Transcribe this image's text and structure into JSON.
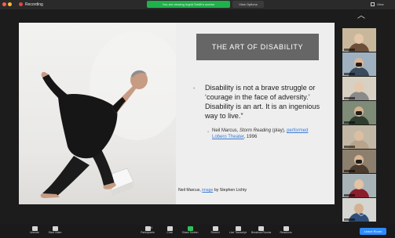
{
  "topbar": {
    "recording_label": "Recording",
    "banner_text": "You are viewing Ingrid Smith's screen",
    "view_options_label": "View Options",
    "view_label": "View",
    "window_dots": [
      "#ff5f57",
      "#febc2e",
      "#28c840"
    ],
    "rec_color": "#e8453c"
  },
  "slide": {
    "title": "THE ART OF DISABILITY",
    "quote": "Disability is not a brave struggle or ‘courage in the face of adversity.’ Disability is an art. It is an ingenious way to live.”",
    "citation_prefix": "Neil Marcus, ",
    "citation_work": "Storm Reading",
    "citation_mid": " (play), ",
    "citation_link": "performed Lobero Theater",
    "citation_year": ", 1996",
    "credit_prefix": "Neil Marcus, ",
    "credit_link": "image",
    "credit_suffix": " by Stephen Lichty"
  },
  "participants": {
    "scroll_up_icon": "chevron-up-icon",
    "scroll_down_icon": "chevron-down-icon",
    "tiles": [
      {
        "wall": "#c9b79c",
        "skin": "#e3c7a8",
        "shirt": "#6b4f3a",
        "mask": false
      },
      {
        "wall": "#9fb0c0",
        "skin": "#d9b597",
        "shirt": "#3a4a5c",
        "mask": true
      },
      {
        "wall": "#d7d0c3",
        "skin": "#e6c9ad",
        "shirt": "#8a8a8a",
        "mask": false
      },
      {
        "wall": "#7e8b77",
        "skin": "#d5b08f",
        "shirt": "#2f3d2f",
        "mask": true
      },
      {
        "wall": "#c3b8a6",
        "skin": "#dcbfa2",
        "shirt": "#b7a48a",
        "mask": false
      },
      {
        "wall": "#8c7f6d",
        "skin": "#d8b796",
        "shirt": "#4a3b2e",
        "mask": true
      },
      {
        "wall": "#a8b3b8",
        "skin": "#e2c3a4",
        "shirt": "#8b1e2b",
        "mask": false
      },
      {
        "wall": "#d5d5d2",
        "skin": "#d4b190",
        "shirt": "#2f4f7a",
        "mask": false
      }
    ]
  },
  "toolbar": {
    "items": [
      {
        "label": "Unmute",
        "icon": "microphone-icon",
        "green": false
      },
      {
        "label": "Start Video",
        "icon": "video-camera-icon",
        "green": false
      },
      {
        "label": "Participants",
        "icon": "participants-icon",
        "green": false
      },
      {
        "label": "Chat",
        "icon": "chat-icon",
        "green": false
      },
      {
        "label": "Share Screen",
        "icon": "share-screen-icon",
        "green": true
      },
      {
        "label": "Record",
        "icon": "record-icon",
        "green": false
      },
      {
        "label": "Live Transcript",
        "icon": "cc-icon",
        "green": false
      },
      {
        "label": "Breakout Rooms",
        "icon": "breakout-rooms-icon",
        "green": false
      },
      {
        "label": "Reactions",
        "icon": "reactions-icon",
        "green": false
      }
    ],
    "participants_count": "34",
    "leave_label": "Leave Room"
  }
}
